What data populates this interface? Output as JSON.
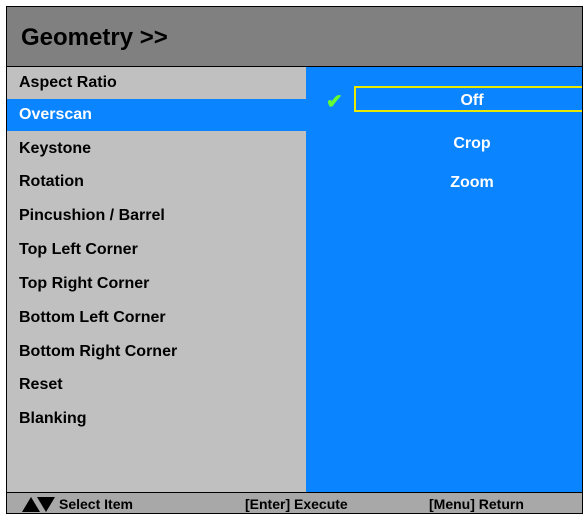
{
  "header": {
    "title": "Geometry >>"
  },
  "menu": {
    "items": [
      {
        "label": "Aspect Ratio"
      },
      {
        "label": "Overscan"
      },
      {
        "label": "Keystone"
      },
      {
        "label": "Rotation"
      },
      {
        "label": "Pincushion / Barrel"
      },
      {
        "label": "Top Left Corner"
      },
      {
        "label": "Top Right Corner"
      },
      {
        "label": "Bottom Left Corner"
      },
      {
        "label": "Bottom Right Corner"
      },
      {
        "label": "Reset"
      },
      {
        "label": "Blanking"
      }
    ],
    "selected": "Overscan"
  },
  "options": {
    "items": [
      {
        "label": "Off"
      },
      {
        "label": "Crop"
      },
      {
        "label": "Zoom"
      }
    ],
    "current": "Off",
    "check_icon": "checkmark-icon"
  },
  "footer": {
    "select_item": "Select Item",
    "execute": "[Enter] Execute",
    "return": "[Menu] Return",
    "nav_icon": "up-down-arrows-icon"
  },
  "colors": {
    "header_bg": "#808080",
    "panel_bg": "#c0c0c0",
    "selection_bg": "#0a84ff",
    "active_border": "#e8e800",
    "check": "#66ff33"
  }
}
